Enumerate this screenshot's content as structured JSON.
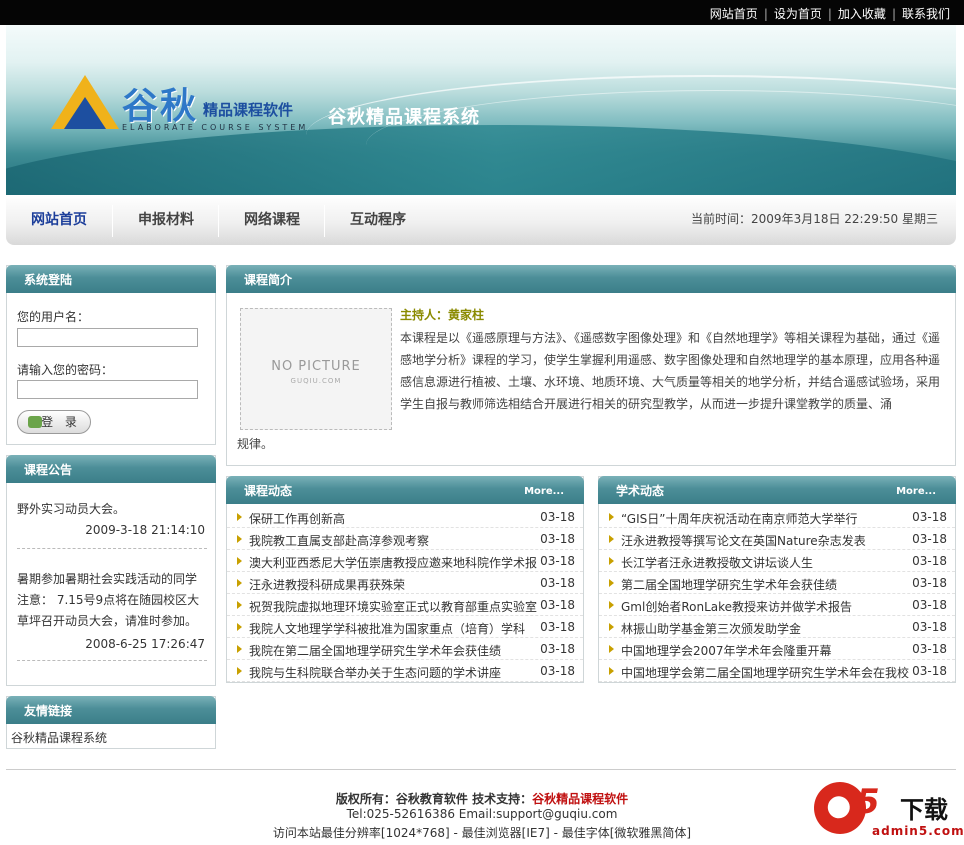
{
  "toplinks": [
    "网站首页",
    "设为首页",
    "加入收藏",
    "联系我们"
  ],
  "banner": {
    "logo_main": "谷秋",
    "logo_sub": "精品课程软件",
    "logo_en": "ELABORATE COURSE SYSTEM",
    "site_title": "谷秋精品课程系统"
  },
  "nav": {
    "items": [
      "网站首页",
      "申报材料",
      "网络课程",
      "互动程序"
    ],
    "time": "当前时间：2009年3月18日 22:29:50 星期三"
  },
  "login": {
    "title": "系统登陆",
    "username_label": "您的用户名：",
    "password_label": "请输入您的密码：",
    "button": "登 录"
  },
  "announce": {
    "title": "课程公告",
    "items": [
      {
        "text": "野外实习动员大会。",
        "date": "2009-3-18 21:14:10"
      },
      {
        "text": "暑期参加暑期社会实践活动的同学注意： 7.15号9点将在随园校区大草坪召开动员大会，请准时参加。",
        "date": "2008-6-25 17:26:47"
      }
    ]
  },
  "friend": {
    "title": "友情链接",
    "link": "谷秋精品课程系统"
  },
  "intro": {
    "title": "课程简介",
    "nopic": "NO PICTURE",
    "nopic_sub": "GUQIU.COM",
    "host": "主持人：黄家柱",
    "text": "本课程是以《遥感原理与方法》、《遥感数字图像处理》和《自然地理学》等相关课程为基础，通过《遥感地学分析》课程的学习，使学生掌握利用遥感、数字图像处理和自然地理学的基本原理，应用各种遥感信息源进行植被、土壤、水环境、地质环境、大气质量等相关的地学分析，并结合遥感试验场，采用学生自报与教师筛选相结合开展进行相关的研究型教学，从而进一步提升课堂教学的质量、涌",
    "text_end": "规律。"
  },
  "course_news": {
    "title": "课程动态",
    "more": "More...",
    "items": [
      {
        "t": "保研工作再创新高",
        "d": "03-18"
      },
      {
        "t": "我院教工直属支部赴高淳参观考察",
        "d": "03-18"
      },
      {
        "t": "澳大利亚西悉尼大学伍崇唐教授应邀来地科院作学术报",
        "d": "03-18"
      },
      {
        "t": "汪永进教授科研成果再获殊荣",
        "d": "03-18"
      },
      {
        "t": "祝贺我院虚拟地理环境实验室正式以教育部重点实验室",
        "d": "03-18"
      },
      {
        "t": "我院人文地理学学科被批准为国家重点（培育）学科",
        "d": "03-18"
      },
      {
        "t": "我院在第二届全国地理学研究生学术年会获佳绩",
        "d": "03-18"
      },
      {
        "t": "我院与生科院联合举办关于生态问题的学术讲座",
        "d": "03-18"
      }
    ]
  },
  "academic_news": {
    "title": "学术动态",
    "more": "More...",
    "items": [
      {
        "t": "“GIS日”十周年庆祝活动在南京师范大学举行",
        "d": "03-18"
      },
      {
        "t": "汪永进教授等撰写论文在英国Nature杂志发表",
        "d": "03-18"
      },
      {
        "t": "长江学者汪永进教授敬文讲坛谈人生",
        "d": "03-18"
      },
      {
        "t": "第二届全国地理学研究生学术年会获佳绩",
        "d": "03-18"
      },
      {
        "t": "Gml创始者RonLake教授来访并做学术报告",
        "d": "03-18"
      },
      {
        "t": "林振山助学基金第三次颁发助学金",
        "d": "03-18"
      },
      {
        "t": "中国地理学会2007年学术年会隆重开幕",
        "d": "03-18"
      },
      {
        "t": "中国地理学会第二届全国地理学研究生学术年会在我校",
        "d": "03-18"
      }
    ]
  },
  "footer": {
    "copyright_prefix": "版权所有：谷秋教育软件  技术支持：",
    "copyright_brand": "谷秋精品课程软件",
    "contact": "Tel:025-52616386  Email:support@guqiu.com",
    "tips": "访问本站最佳分辨率[1024*768] - 最佳浏览器[IE7] - 最佳字体[微软雅黑简体]"
  },
  "watermark": {
    "logo_a": "a",
    "logo_5": "5",
    "logo_dl": "下载",
    "url": "admin5.com"
  }
}
